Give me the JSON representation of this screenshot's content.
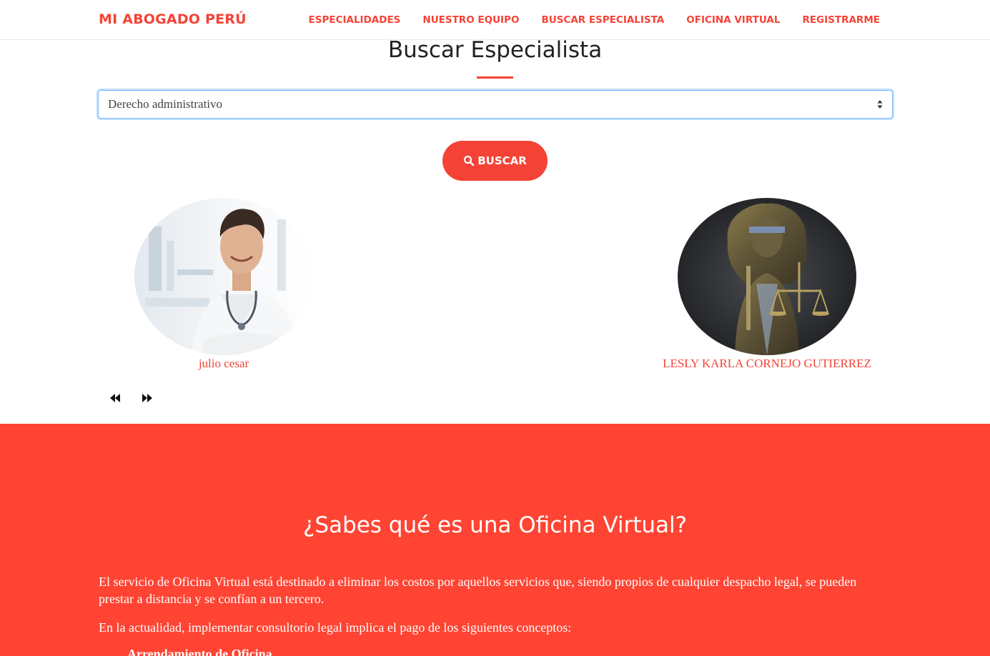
{
  "navbar": {
    "brand": "MI ABOGADO PERÚ",
    "links": [
      "ESPECIALIDADES",
      "NUESTRO EQUIPO",
      "BUSCAR ESPECIALISTA",
      "OFICINA VIRTUAL",
      "REGISTRARME"
    ]
  },
  "search": {
    "title": "Buscar Especialista",
    "selected_specialty": "Derecho administrativo",
    "button_label": "BUSCAR"
  },
  "specialists": [
    {
      "name": "julio cesar"
    },
    {
      "name": "LESLY KARLA CORNEJO GUTIERREZ"
    }
  ],
  "info": {
    "title": "¿Sabes qué es una Oficina Virtual?",
    "paragraph1": "El servicio de Oficina Virtual está destinado a eliminar los costos por aquellos servicios que, siendo propios de cualquier despacho legal, se pueden prestar a distancia y se confían a un tercero.",
    "paragraph2": "En la actualidad, implementar consultorio legal implica el pago de los siguientes conceptos:",
    "list_item_1": "Arrendamiento de Oficina"
  },
  "colors": {
    "accent": "#f44336",
    "section_red": "#ff4433"
  }
}
